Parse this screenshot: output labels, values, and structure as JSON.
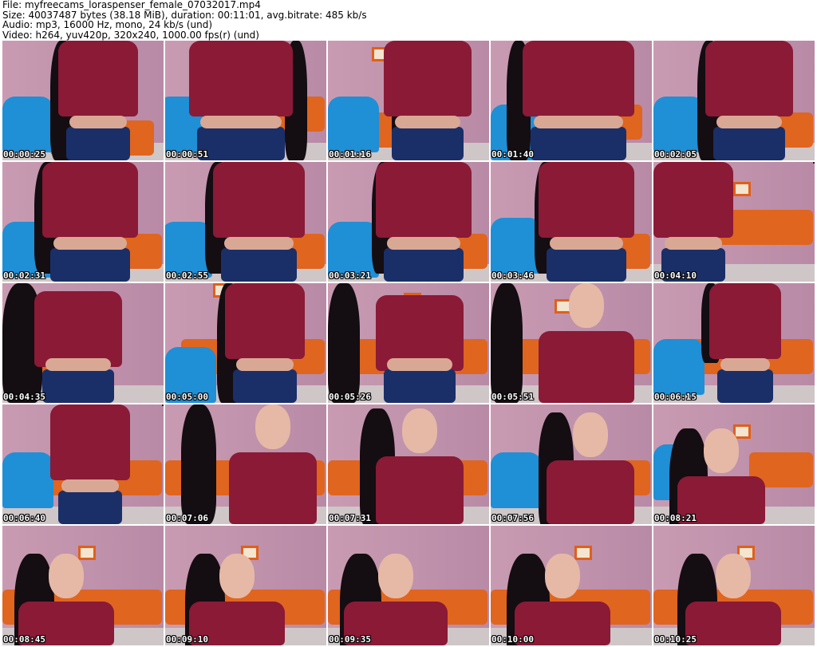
{
  "header": {
    "file_line": "File: myfreecams_loraspenser_female_07032017.mp4",
    "size_line": "Size: 40037487 bytes (38.18 MiB), duration: 00:11:01, avg.bitrate: 485 kb/s",
    "audio_line": "Audio: mp3, 16000 Hz, mono, 24 kb/s (und)",
    "video_line": "Video: h264, yuv420p, 320x240, 1000.00 fps(r) (und)"
  },
  "thumbnails": [
    "00:00:25",
    "00:00:51",
    "00:01:16",
    "00:01:40",
    "00:02:05",
    "00:02:31",
    "00:02:55",
    "00:03:21",
    "00:03:46",
    "00:04:10",
    "00:04:35",
    "00:05:00",
    "00:05:26",
    "00:05:51",
    "00:06:15",
    "00:06:40",
    "00:07:06",
    "00:07:31",
    "00:07:56",
    "00:08:21",
    "00:08:45",
    "00:09:10",
    "00:09:35",
    "00:10:00",
    "00:10:25"
  ],
  "colors": {
    "wall": "#c99bb2",
    "wall_right": "#b88aa6",
    "top": "#8a1a36",
    "skirt": "#1a2f67",
    "hair": "#140d12",
    "chair_blue": "#1f8fd6",
    "chair_orange": "#e0651f"
  }
}
